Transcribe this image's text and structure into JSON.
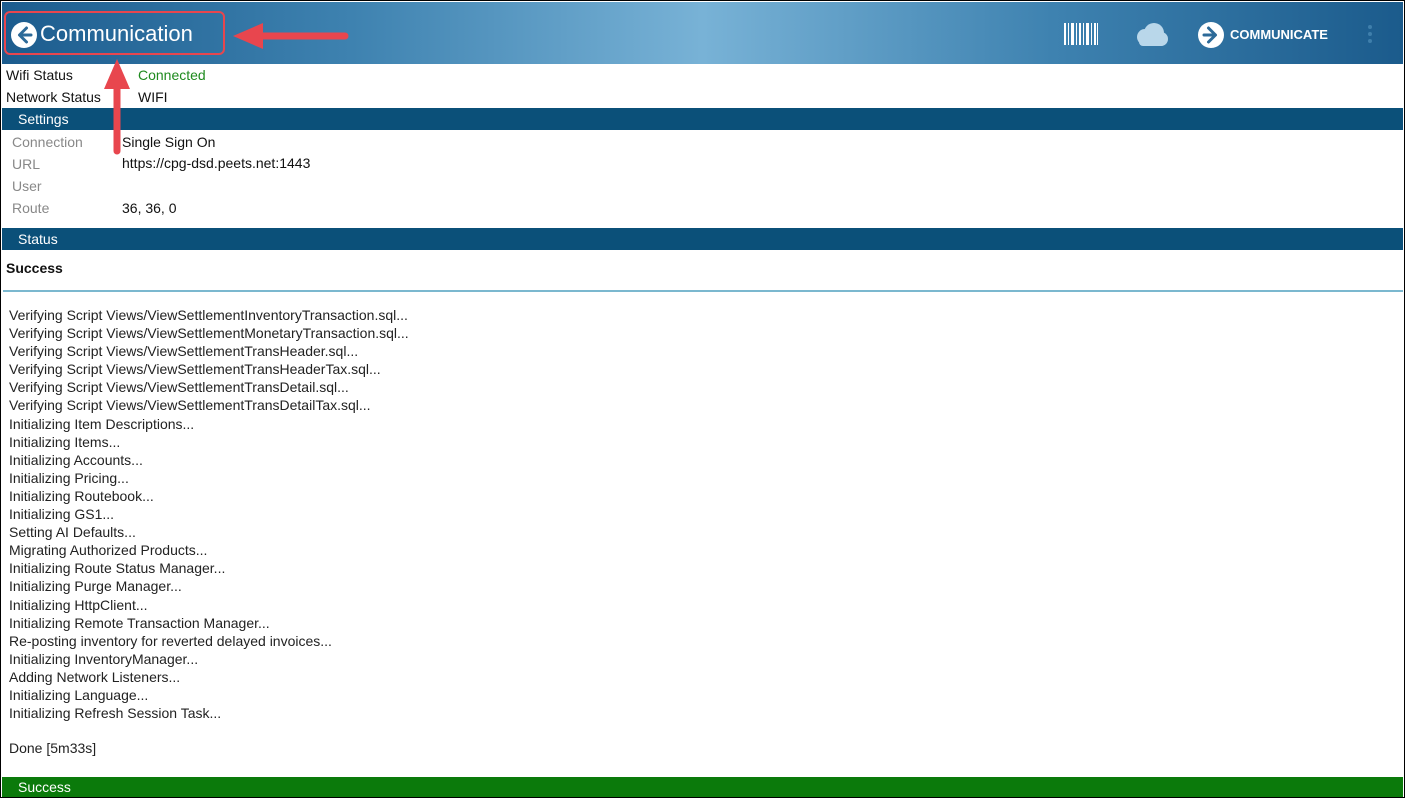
{
  "appbar": {
    "title": "Communication",
    "back_icon": "arrow-left-circle-icon",
    "actions": [
      {
        "icon": "barcode-icon"
      },
      {
        "icon": "cloud-icon"
      },
      {
        "icon": "arrow-right-circle-icon",
        "label": "COMMUNICATE"
      },
      {
        "icon": "overflow-menu-icon"
      }
    ],
    "accent": "#3e82b0",
    "annotation_color": "#e8464e"
  },
  "network": {
    "wifi_label": "Wifi Status",
    "wifi_value": "Connected",
    "network_label": "Network Status",
    "network_value": "WIFI",
    "connected_color": "#1e8a1e"
  },
  "settings": {
    "header": "Settings",
    "connection_label": "Connection",
    "connection_value": "Single Sign On",
    "url_label": "URL",
    "url_value": "https://cpg-dsd.peets.net:1443",
    "user_label": "User",
    "user_value": "",
    "route_label": "Route",
    "route_value": "36, 36, 0"
  },
  "status": {
    "header": "Status",
    "result": "Success",
    "log": [
      "Verifying Script Views/ViewSettlementInventoryTransaction.sql...",
      "Verifying Script Views/ViewSettlementMonetaryTransaction.sql...",
      "Verifying Script Views/ViewSettlementTransHeader.sql...",
      "Verifying Script Views/ViewSettlementTransHeaderTax.sql...",
      "Verifying Script Views/ViewSettlementTransDetail.sql...",
      "Verifying Script Views/ViewSettlementTransDetailTax.sql...",
      "Initializing Item Descriptions...",
      "Initializing Items...",
      "Initializing Accounts...",
      "Initializing Pricing...",
      "Initializing Routebook...",
      "Initializing GS1...",
      "Setting AI Defaults...",
      "Migrating Authorized Products...",
      "Initializing Route Status Manager...",
      "Initializing Purge Manager...",
      "Initializing HttpClient...",
      "Initializing Remote Transaction Manager...",
      "Re-posting inventory for reverted delayed invoices...",
      "Initializing InventoryManager...",
      "Adding Network Listeners...",
      "Initializing Language...",
      "Initializing Refresh Session Task..."
    ],
    "done": "Done [5m33s]",
    "footer": "Success",
    "header_color": "#0b5079",
    "success_color": "#0b7a0b"
  }
}
